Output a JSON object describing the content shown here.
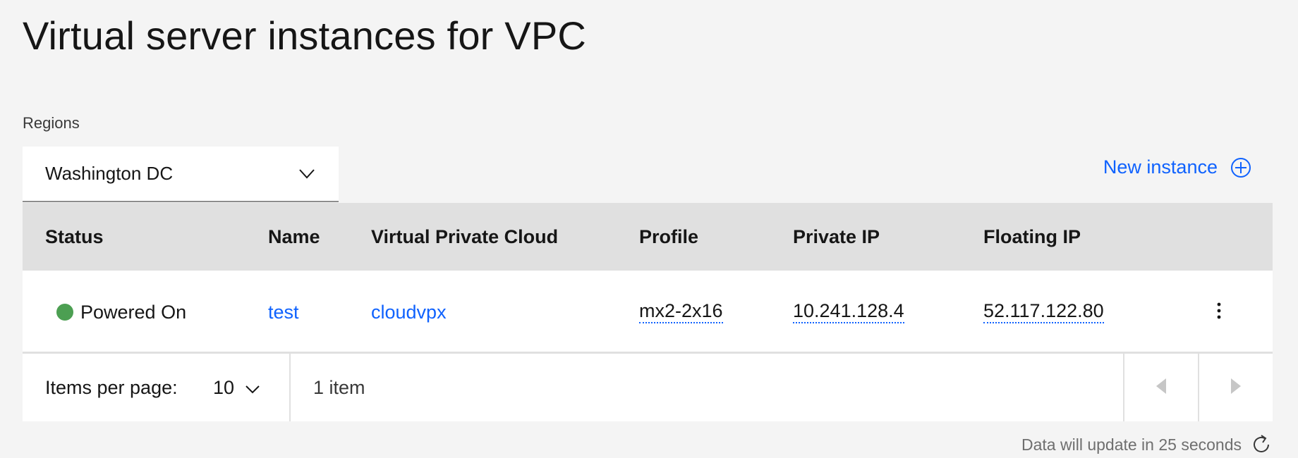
{
  "page": {
    "title": "Virtual server instances for VPC"
  },
  "regions": {
    "label": "Regions",
    "selected": "Washington DC"
  },
  "actions": {
    "new_instance_label": "New instance",
    "new_instance_icon": "add-circle-icon"
  },
  "table": {
    "columns": [
      "Status",
      "Name",
      "Virtual Private Cloud",
      "Profile",
      "Private IP",
      "Floating IP"
    ],
    "rows": [
      {
        "status": "Powered On",
        "status_color": "#4c9f52",
        "name": "test",
        "vpc": "cloudvpx",
        "profile": "mx2-2x16",
        "private_ip": "10.241.128.4",
        "floating_ip": "52.117.122.80"
      }
    ]
  },
  "pagination": {
    "items_per_page_label": "Items per page:",
    "items_per_page_value": "10",
    "item_count": "1 item"
  },
  "refresh": {
    "note": "Data will update in 25 seconds",
    "icon": "refresh-icon"
  },
  "colors": {
    "accent": "#0f62fe",
    "header_bg": "#e0e0e0",
    "page_bg": "#f4f4f4",
    "success": "#4c9f52"
  }
}
